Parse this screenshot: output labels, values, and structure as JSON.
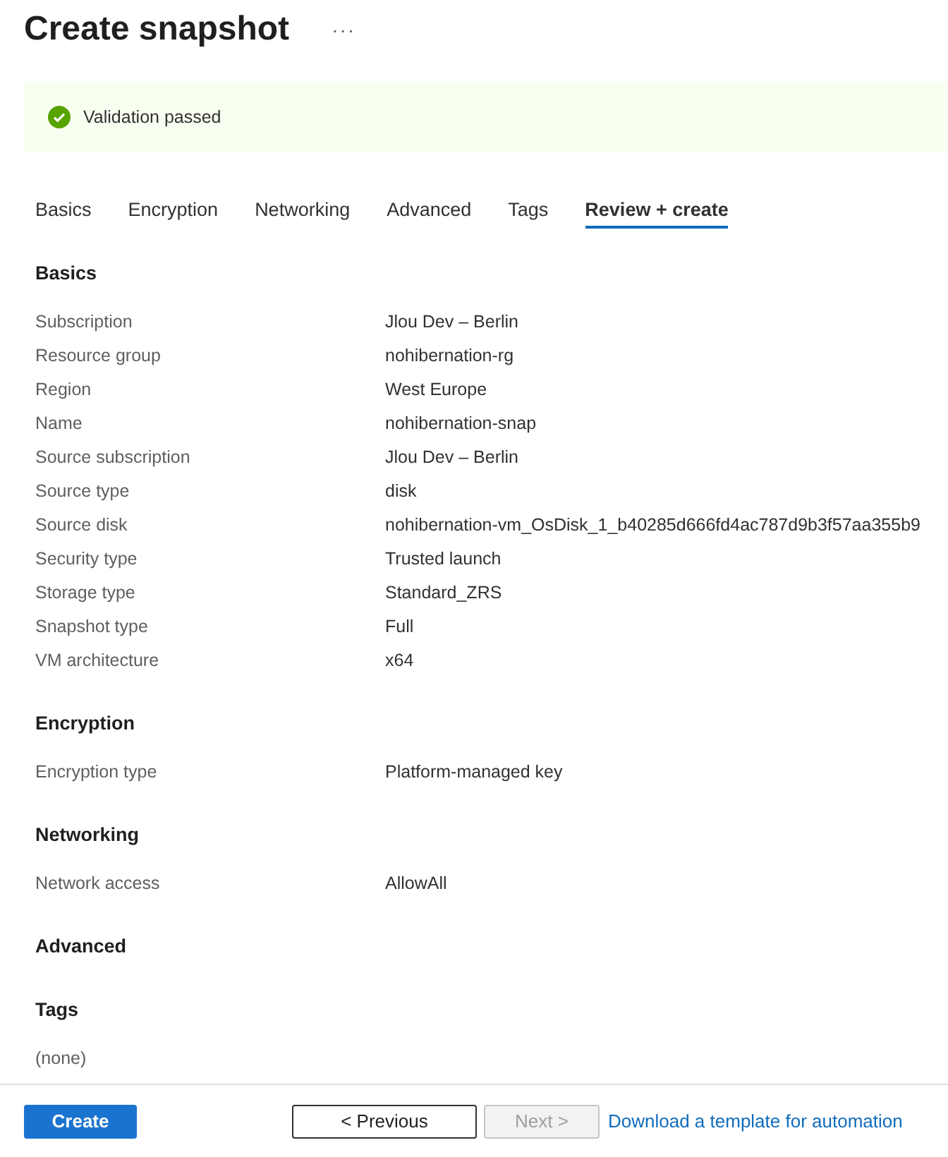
{
  "header": {
    "title": "Create snapshot",
    "more": "···"
  },
  "banner": {
    "kind": "success",
    "text": "Validation passed"
  },
  "tabs": [
    {
      "label": "Basics",
      "selected": false
    },
    {
      "label": "Encryption",
      "selected": false
    },
    {
      "label": "Networking",
      "selected": false
    },
    {
      "label": "Advanced",
      "selected": false
    },
    {
      "label": "Tags",
      "selected": false
    },
    {
      "label": "Review + create",
      "selected": true
    }
  ],
  "sections": [
    {
      "title": "Basics",
      "rows": [
        {
          "label": "Subscription",
          "value": "Jlou Dev – Berlin"
        },
        {
          "label": "Resource group",
          "value": "nohibernation-rg"
        },
        {
          "label": "Region",
          "value": "West Europe"
        },
        {
          "label": "Name",
          "value": "nohibernation-snap"
        },
        {
          "label": "Source subscription",
          "value": "Jlou Dev – Berlin"
        },
        {
          "label": "Source type",
          "value": "disk"
        },
        {
          "label": "Source disk",
          "value": "nohibernation-vm_OsDisk_1_b40285d666fd4ac787d9b3f57aa355b9"
        },
        {
          "label": "Security type",
          "value": "Trusted launch"
        },
        {
          "label": "Storage type",
          "value": "Standard_ZRS"
        },
        {
          "label": "Snapshot type",
          "value": "Full"
        },
        {
          "label": "VM architecture",
          "value": "x64"
        }
      ]
    },
    {
      "title": "Encryption",
      "rows": [
        {
          "label": "Encryption type",
          "value": "Platform-managed key"
        }
      ]
    },
    {
      "title": "Networking",
      "rows": [
        {
          "label": "Network access",
          "value": "AllowAll"
        }
      ]
    },
    {
      "title": "Advanced"
    },
    {
      "title": "Tags",
      "note": "(none)"
    }
  ],
  "footer": {
    "buttons": [
      {
        "label": "Create",
        "kind": "primary",
        "disabled": false
      },
      {
        "label": "< Previous",
        "kind": "secondary",
        "disabled": false
      },
      {
        "label": "Next >",
        "kind": "secondary",
        "disabled": true
      }
    ],
    "link": "Download a template for automation"
  }
}
